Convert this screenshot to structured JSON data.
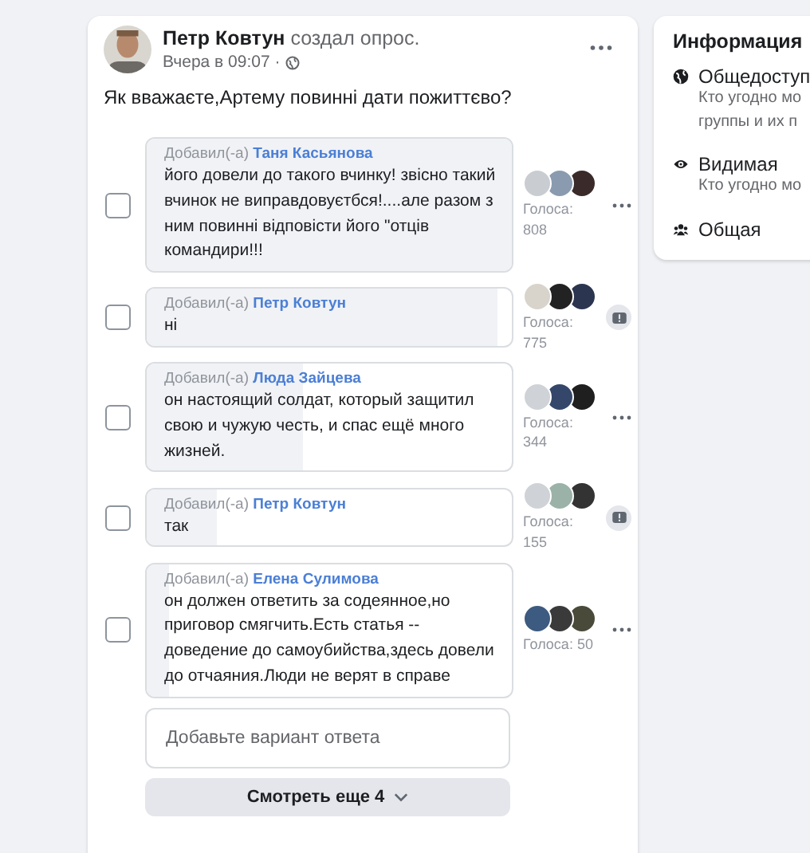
{
  "post": {
    "author": "Петр Ковтун",
    "action": "создал опрос.",
    "time": "Вчера в 09:07 ·",
    "question": "Як вважаєте,Артему повинні дати пожиттєво?",
    "options": [
      {
        "added_by": "Добавил(-а)",
        "author": "Таня Касьянова",
        "text": "його довели до такого вчинку! звісно такий вчинок не виправдовуєтбся!....але разом з ним повинні відповісти його \"отців командири!!!",
        "level": 1.0,
        "checked": false,
        "votes": "Голоса: 808",
        "kind": "more"
      },
      {
        "added_by": "Добавил(-а)",
        "author": "Петр Ковтун",
        "text": "ні",
        "level": 0.96,
        "checked": false,
        "votes": "Голоса: 775",
        "kind": "badge"
      },
      {
        "added_by": "Добавил(-а)",
        "author": "Люда Зайцева",
        "text": "он настоящий солдат, который защитил свою и чужую честь, и спас ещё много жизней.",
        "level": 0.43,
        "checked": false,
        "votes": "Голоса: 344",
        "kind": "more"
      },
      {
        "added_by": "Добавил(-а)",
        "author": "Петр Ковтун",
        "text": "так",
        "level": 0.19,
        "checked": false,
        "votes": "Голоса: 155",
        "kind": "badge"
      },
      {
        "added_by": "Добавил(-а)",
        "author": "Елена Сулимова",
        "text": "он должен ответить за содеянное,но приговор смягчить.Есть статья --доведение до самоубийства,здесь довели до отчаяния.Люди не верят в справе",
        "level": 0.06,
        "checked": false,
        "votes": "Голоса: 50",
        "kind": "more"
      }
    ],
    "add_option": {
      "placeholder": "Добавьте вариант ответа"
    },
    "see_more": "Смотреть еще 4"
  },
  "info": {
    "title": "Информация",
    "items": [
      {
        "kind": "globe",
        "title": "Общедоступ",
        "lines": [
          "Кто угодно мо",
          "группы и их п"
        ]
      },
      {
        "kind": "eye",
        "title": "Видимая",
        "lines": [
          "Кто угодно мо"
        ]
      },
      {
        "kind": "people",
        "title": "Общая"
      }
    ]
  }
}
